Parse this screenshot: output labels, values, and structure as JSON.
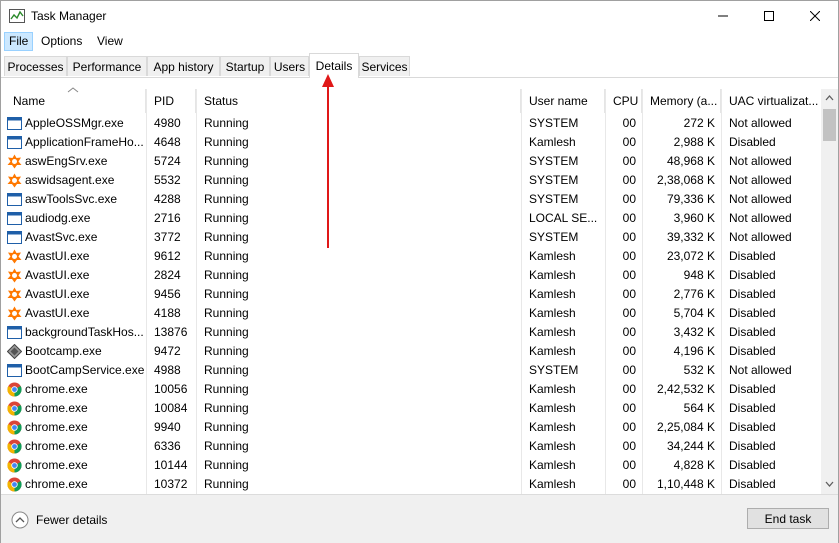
{
  "window": {
    "title": "Task Manager"
  },
  "menu": [
    "File",
    "Options",
    "View"
  ],
  "tabs": [
    "Processes",
    "Performance",
    "App history",
    "Startup",
    "Users",
    "Details",
    "Services"
  ],
  "columns": {
    "name": "Name",
    "pid": "PID",
    "status": "Status",
    "user": "User name",
    "cpu": "CPU",
    "memory": "Memory (a...",
    "uac": "UAC virtualizat..."
  },
  "rows": [
    {
      "name": "AppleOSSMgr.exe",
      "pid": "4980",
      "status": "Running",
      "user": "SYSTEM",
      "cpu": "00",
      "memory": "272 K",
      "uac": "Not allowed",
      "icon": "window-icon"
    },
    {
      "name": "ApplicationFrameHo...",
      "pid": "4648",
      "status": "Running",
      "user": "Kamlesh",
      "cpu": "00",
      "memory": "2,988 K",
      "uac": "Disabled",
      "icon": "window-icon"
    },
    {
      "name": "aswEngSrv.exe",
      "pid": "5724",
      "status": "Running",
      "user": "SYSTEM",
      "cpu": "00",
      "memory": "48,968 K",
      "uac": "Not allowed",
      "icon": "avast-icon"
    },
    {
      "name": "aswidsagent.exe",
      "pid": "5532",
      "status": "Running",
      "user": "SYSTEM",
      "cpu": "00",
      "memory": "2,38,068 K",
      "uac": "Not allowed",
      "icon": "avast-icon"
    },
    {
      "name": "aswToolsSvc.exe",
      "pid": "4288",
      "status": "Running",
      "user": "SYSTEM",
      "cpu": "00",
      "memory": "79,336 K",
      "uac": "Not allowed",
      "icon": "window-icon"
    },
    {
      "name": "audiodg.exe",
      "pid": "2716",
      "status": "Running",
      "user": "LOCAL SE...",
      "cpu": "00",
      "memory": "3,960 K",
      "uac": "Not allowed",
      "icon": "window-icon"
    },
    {
      "name": "AvastSvc.exe",
      "pid": "3772",
      "status": "Running",
      "user": "SYSTEM",
      "cpu": "00",
      "memory": "39,332 K",
      "uac": "Not allowed",
      "icon": "window-icon"
    },
    {
      "name": "AvastUI.exe",
      "pid": "9612",
      "status": "Running",
      "user": "Kamlesh",
      "cpu": "00",
      "memory": "23,072 K",
      "uac": "Disabled",
      "icon": "avast-icon"
    },
    {
      "name": "AvastUI.exe",
      "pid": "2824",
      "status": "Running",
      "user": "Kamlesh",
      "cpu": "00",
      "memory": "948 K",
      "uac": "Disabled",
      "icon": "avast-icon"
    },
    {
      "name": "AvastUI.exe",
      "pid": "9456",
      "status": "Running",
      "user": "Kamlesh",
      "cpu": "00",
      "memory": "2,776 K",
      "uac": "Disabled",
      "icon": "avast-icon"
    },
    {
      "name": "AvastUI.exe",
      "pid": "4188",
      "status": "Running",
      "user": "Kamlesh",
      "cpu": "00",
      "memory": "5,704 K",
      "uac": "Disabled",
      "icon": "avast-icon"
    },
    {
      "name": "backgroundTaskHos...",
      "pid": "13876",
      "status": "Running",
      "user": "Kamlesh",
      "cpu": "00",
      "memory": "3,432 K",
      "uac": "Disabled",
      "icon": "window-icon"
    },
    {
      "name": "Bootcamp.exe",
      "pid": "9472",
      "status": "Running",
      "user": "Kamlesh",
      "cpu": "00",
      "memory": "4,196 K",
      "uac": "Disabled",
      "icon": "bootcamp-icon"
    },
    {
      "name": "BootCampService.exe",
      "pid": "4988",
      "status": "Running",
      "user": "SYSTEM",
      "cpu": "00",
      "memory": "532 K",
      "uac": "Not allowed",
      "icon": "window-icon"
    },
    {
      "name": "chrome.exe",
      "pid": "10056",
      "status": "Running",
      "user": "Kamlesh",
      "cpu": "00",
      "memory": "2,42,532 K",
      "uac": "Disabled",
      "icon": "chrome-icon"
    },
    {
      "name": "chrome.exe",
      "pid": "10084",
      "status": "Running",
      "user": "Kamlesh",
      "cpu": "00",
      "memory": "564 K",
      "uac": "Disabled",
      "icon": "chrome-icon"
    },
    {
      "name": "chrome.exe",
      "pid": "9940",
      "status": "Running",
      "user": "Kamlesh",
      "cpu": "00",
      "memory": "2,25,084 K",
      "uac": "Disabled",
      "icon": "chrome-icon"
    },
    {
      "name": "chrome.exe",
      "pid": "6336",
      "status": "Running",
      "user": "Kamlesh",
      "cpu": "00",
      "memory": "34,244 K",
      "uac": "Disabled",
      "icon": "chrome-icon"
    },
    {
      "name": "chrome.exe",
      "pid": "10144",
      "status": "Running",
      "user": "Kamlesh",
      "cpu": "00",
      "memory": "4,828 K",
      "uac": "Disabled",
      "icon": "chrome-icon"
    },
    {
      "name": "chrome.exe",
      "pid": "10372",
      "status": "Running",
      "user": "Kamlesh",
      "cpu": "00",
      "memory": "1,10,448 K",
      "uac": "Disabled",
      "icon": "chrome-icon"
    }
  ],
  "footer": {
    "fewer_details": "Fewer details",
    "end_task": "End task"
  },
  "colors": {
    "accent": "#0078d7",
    "annotation": "#e01818",
    "avast": "#ff7800"
  }
}
